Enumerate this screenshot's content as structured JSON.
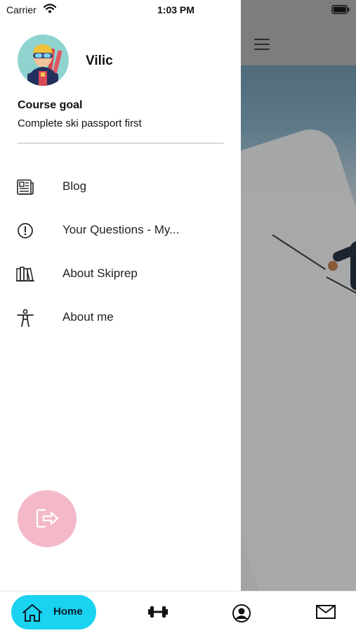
{
  "status_bar": {
    "carrier": "Carrier",
    "time": "1:03 PM",
    "wifi_icon": "wifi-icon",
    "battery_icon": "battery-icon"
  },
  "profile": {
    "name": "Vilic",
    "avatar_icon": "skier-avatar"
  },
  "course_goal": {
    "title": "Course goal",
    "text": "Complete ski passport first"
  },
  "menu": {
    "items": [
      {
        "label": "Blog",
        "icon": "newspaper-icon"
      },
      {
        "label": "Your Questions - My...",
        "icon": "exclamation-circle-icon"
      },
      {
        "label": "About Skiprep",
        "icon": "books-icon"
      },
      {
        "label": "About me",
        "icon": "person-icon"
      }
    ]
  },
  "logout": {
    "icon": "logout-icon"
  },
  "background_screen": {
    "menu_icon": "hamburger-icon"
  },
  "tab_bar": {
    "home_label": "Home",
    "tabs": [
      {
        "icon": "home-icon",
        "label": "Home",
        "active": true
      },
      {
        "icon": "dumbbell-icon"
      },
      {
        "icon": "user-circle-icon"
      },
      {
        "icon": "mail-icon"
      }
    ]
  },
  "colors": {
    "accent": "#19d3f0",
    "logout_bg": "#f3b9c8",
    "divider": "#b9b9b9"
  }
}
